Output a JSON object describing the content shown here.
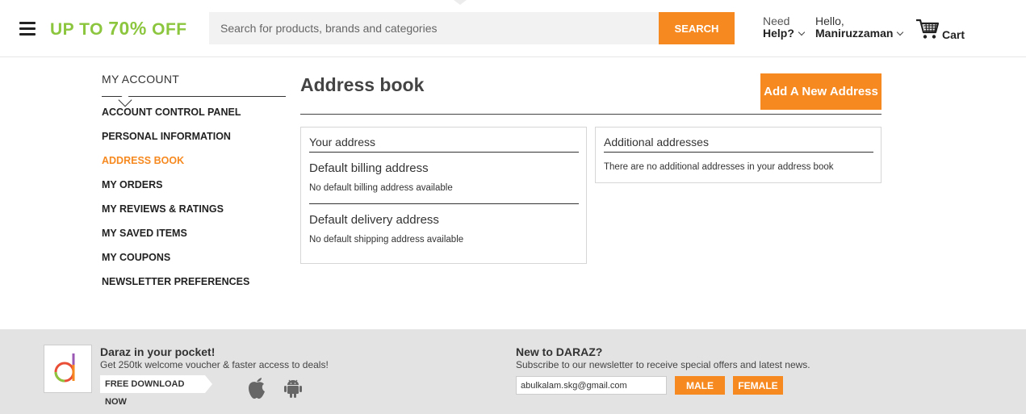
{
  "header": {
    "promo_prefix": "UP TO ",
    "promo_big": "70%",
    "promo_suffix": " OFF",
    "search_placeholder": "Search for products, brands and categories",
    "search_button": "SEARCH",
    "help_line1": "Need",
    "help_line2": "Help?",
    "hello_line1": "Hello,",
    "hello_line2": "Maniruzzaman",
    "cart_label": "Cart",
    "icons": [
      "menu-icon",
      "cart-icon",
      "chevron-down-icon"
    ]
  },
  "sidebar": {
    "title": "MY ACCOUNT",
    "items": [
      {
        "label": "ACCOUNT CONTROL PANEL",
        "active": false
      },
      {
        "label": "PERSONAL INFORMATION",
        "active": false
      },
      {
        "label": "ADDRESS BOOK",
        "active": true
      },
      {
        "label": "MY ORDERS",
        "active": false
      },
      {
        "label": "MY REVIEWS & RATINGS",
        "active": false
      },
      {
        "label": "MY SAVED ITEMS",
        "active": false
      },
      {
        "label": "MY COUPONS",
        "active": false
      },
      {
        "label": "NEWSLETTER PREFERENCES",
        "active": false
      }
    ]
  },
  "main": {
    "title": "Address book",
    "add_button": "Add A New Address",
    "your_address": {
      "heading": "Your address",
      "billing_heading": "Default billing address",
      "billing_text": "No default billing address available",
      "delivery_heading": "Default delivery address",
      "delivery_text": "No default shipping address available"
    },
    "additional": {
      "heading": "Additional addresses",
      "text": "There are no additional addresses in your address book"
    }
  },
  "footer": {
    "pocket_title": "Daraz in your pocket!",
    "pocket_sub": "Get 250tk welcome voucher & faster access to deals!",
    "download_label": "FREE DOWNLOAD NOW",
    "news_title": "New to DARAZ?",
    "news_sub": "Subscribe to our newsletter to receive special offers and latest news.",
    "email_value": "abulkalam.skg@gmail.com",
    "male_button": "MALE",
    "female_button": "FEMALE",
    "icons": [
      "daraz-logo-icon",
      "apple-icon",
      "android-icon"
    ]
  },
  "colors": {
    "accent": "#f6891f",
    "promo_green": "#8cc63f",
    "footer_bg": "#e3e3e3"
  }
}
